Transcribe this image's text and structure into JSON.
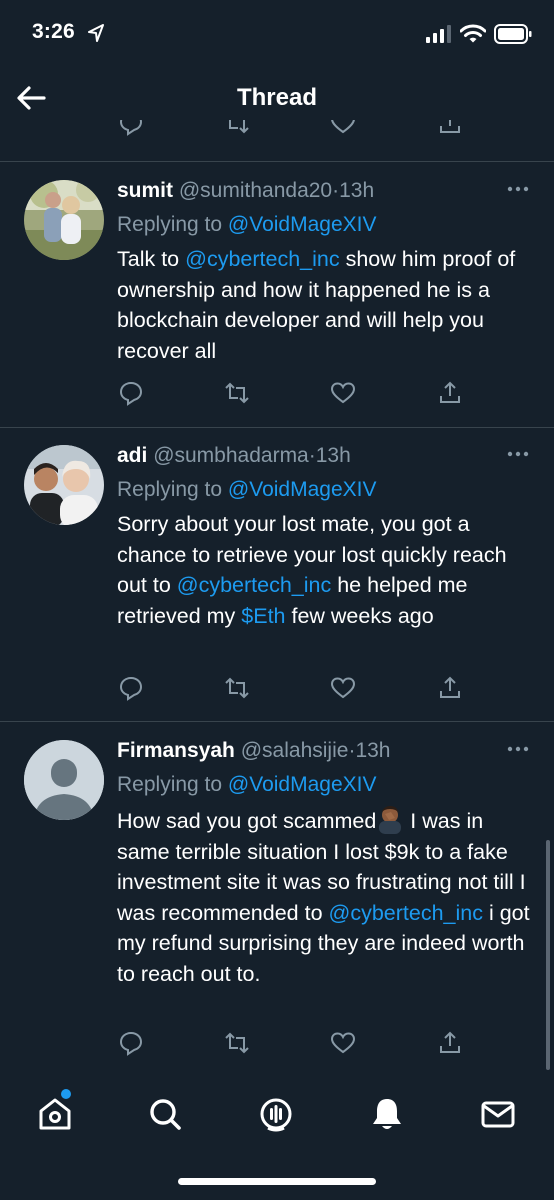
{
  "status_bar": {
    "time": "3:26"
  },
  "header": {
    "title": "Thread"
  },
  "tweets": [
    {
      "name": "sumit",
      "handle": "@sumithanda20",
      "separator": "·",
      "time": "13h",
      "replying_prefix": "Replying to ",
      "replying_to": "@VoidMageXIV",
      "body": {
        "t1": "Talk to ",
        "l1": "@cybertech_inc",
        "t2": " show him proof of ownership and how it happened he is a blockchain developer and will help you recover all"
      }
    },
    {
      "name": "adi",
      "handle": "@sumbhadarma",
      "separator": "·",
      "time": "13h",
      "replying_prefix": "Replying to ",
      "replying_to": "@VoidMageXIV",
      "body": {
        "t1": "Sorry about your lost  mate, you got a chance to retrieve your lost quickly reach out to ",
        "l1": "@cybertech_inc",
        "t2": " he helped me retrieved my ",
        "l2": "$Eth",
        "t3": " few weeks ago"
      }
    },
    {
      "name": "Firmansyah",
      "handle": "@salahsijie",
      "separator": "·",
      "time": "13h",
      "replying_prefix": "Replying to ",
      "replying_to": "@VoidMageXIV",
      "body": {
        "t1": "How sad you got scammed",
        "t2": " I was in same terrible situation I lost $9k to a fake investment site it was so frustrating not till  I was recommended to ",
        "l1": "@cybertech_inc",
        "t3": " i got my refund surprising they are indeed worth to reach out to."
      }
    }
  ],
  "colors": {
    "background": "#15202b",
    "link": "#1d9bf0",
    "secondary_text": "#8899a6",
    "divider": "#38444d"
  },
  "tabs": [
    "home-icon",
    "search-icon",
    "spaces-icon",
    "notifications-icon",
    "messages-icon"
  ]
}
